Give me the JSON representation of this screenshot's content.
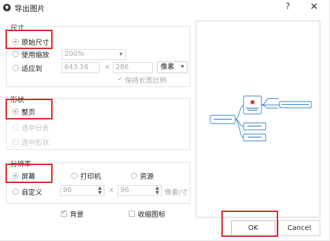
{
  "window": {
    "title": "导出图片",
    "help_label": "?",
    "close_label": "✕"
  },
  "size_section": {
    "title": "尺寸",
    "original_size": "原始尺寸",
    "use_zoom": "使用缩放",
    "zoom_value": "200%",
    "fit_to": "适应到",
    "width_value": "643.16",
    "height_value": "286",
    "times": "×",
    "unit_label": "像素",
    "keep_ratio": "保持长宽比例"
  },
  "shape_section": {
    "title": "形状",
    "whole_page": "整页",
    "selected_branch": "选中分支",
    "selected_shape": "选中形状"
  },
  "resolution_section": {
    "title": "分辨率",
    "screen": "屏幕",
    "printer": "打印机",
    "source": "资源",
    "custom": "自定义",
    "dpi_x": "96",
    "dpi_y": "96",
    "times": "x",
    "dpi_unit": "像素/寸"
  },
  "options": {
    "background": "背景",
    "collapse_icon": "收缩图标"
  },
  "buttons": {
    "ok": "OK",
    "cancel": "Cancel"
  },
  "colors": {
    "highlight": "#e02020",
    "mindmap_line": "#2f7fc9",
    "central_icon": "#d9393a"
  }
}
